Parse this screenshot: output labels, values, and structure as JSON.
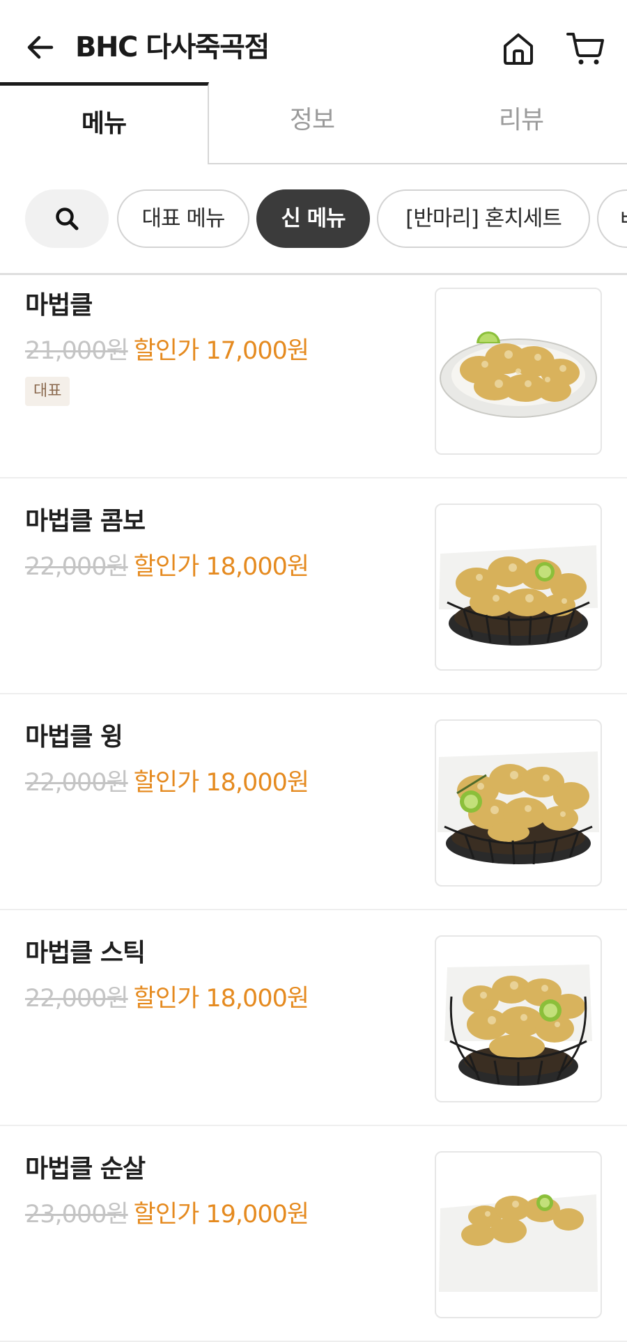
{
  "header": {
    "store_name": "BHC 다사죽곡점",
    "back_icon": "arrow-left-icon",
    "home_icon": "home-icon",
    "cart_icon": "cart-icon"
  },
  "tabs": [
    {
      "label": "메뉴",
      "active": true
    },
    {
      "label": "정보",
      "active": false
    },
    {
      "label": "리뷰",
      "active": false
    }
  ],
  "categories": {
    "search_icon": "search-icon",
    "chips": [
      {
        "label": "대표 메뉴",
        "selected": false
      },
      {
        "label": "신 메뉴",
        "selected": true
      },
      {
        "label": "[반마리] 혼치세트",
        "selected": false
      },
      {
        "label": "ㅂ",
        "selected": false
      }
    ]
  },
  "menu_items": [
    {
      "name": "마법클",
      "original_price": "21,000원",
      "sale_price": "할인가 17,000원",
      "badge": "대표",
      "image": "chicken-plate"
    },
    {
      "name": "마법클 콤보",
      "original_price": "22,000원",
      "sale_price": "할인가 18,000원",
      "image": "chicken-basket"
    },
    {
      "name": "마법클 윙",
      "original_price": "22,000원",
      "sale_price": "할인가 18,000원",
      "image": "chicken-basket"
    },
    {
      "name": "마법클 스틱",
      "original_price": "22,000원",
      "sale_price": "할인가 18,000원",
      "image": "chicken-basket"
    },
    {
      "name": "마법클 순살",
      "original_price": "23,000원",
      "sale_price": "할인가 19,000원",
      "image": "chicken-basket"
    }
  ],
  "colors": {
    "accent_orange": "#e58a1f",
    "strike_gray": "#c4c4c4",
    "chip_selected_bg": "#3b3b3b",
    "badge_bg": "#f4efe9"
  }
}
